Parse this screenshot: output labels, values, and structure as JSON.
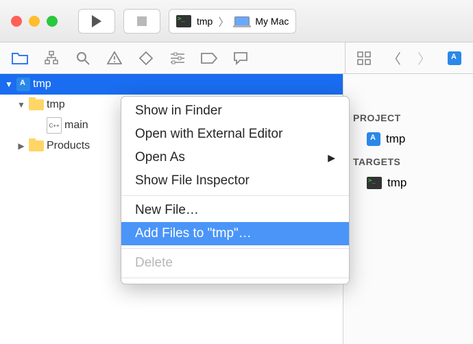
{
  "titlebar": {
    "scheme_name": "tmp",
    "destination": "My Mac"
  },
  "navigator_tabs": {
    "project": "project",
    "hierarchy": "hierarchy",
    "search": "search",
    "issues": "issues",
    "tests": "tests",
    "debug": "debug",
    "breakpoints": "breakpoints",
    "logs": "logs"
  },
  "tree": {
    "root": "tmp",
    "group": "tmp",
    "file": "main",
    "products": "Products"
  },
  "context_menu": {
    "show_in_finder": "Show in Finder",
    "open_external": "Open with External Editor",
    "open_as": "Open As",
    "show_inspector": "Show File Inspector",
    "new_file": "New File…",
    "add_files": "Add Files to \"tmp\"…",
    "delete": "Delete"
  },
  "inspector": {
    "project_header": "PROJECT",
    "project_name": "tmp",
    "targets_header": "TARGETS",
    "target_name": "tmp"
  }
}
